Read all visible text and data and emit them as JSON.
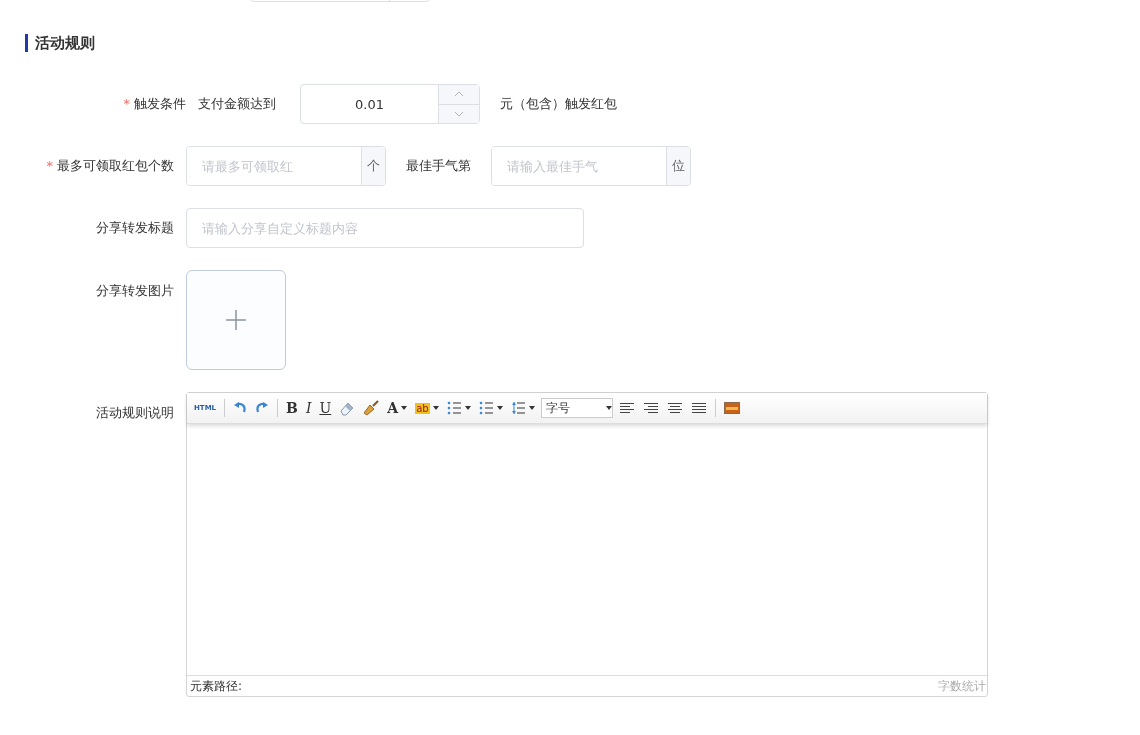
{
  "section": {
    "title": "活动规则"
  },
  "form": [
    {
      "kind": "trigger",
      "label": "触发条件",
      "required_mark": "*",
      "prefix": "支付金额达到",
      "value": "0.01",
      "suffix": "元（包含）触发红包"
    },
    {
      "kind": "pair",
      "label": "最多可领取红包个数",
      "required_mark": "*",
      "placeholder": "请最多可领取红",
      "unit": "个",
      "second_label": "最佳手气第",
      "second_placeholder": "请输入最佳手气",
      "second_unit": "位"
    },
    {
      "kind": "text",
      "label": "分享转发标题",
      "placeholder": "请输入分享自定义标题内容"
    },
    {
      "kind": "upload",
      "label": "分享转发图片"
    },
    {
      "kind": "editor",
      "label": "活动规则说明"
    }
  ],
  "editor": {
    "toolbar": [
      {
        "kind": "html",
        "text": "HTML"
      },
      {
        "kind": "sep"
      },
      {
        "kind": "undo"
      },
      {
        "kind": "redo"
      },
      {
        "kind": "sep"
      },
      {
        "kind": "bold",
        "text": "B"
      },
      {
        "kind": "italic",
        "text": "I"
      },
      {
        "kind": "underline",
        "text": "U"
      },
      {
        "kind": "eraser"
      },
      {
        "kind": "brush"
      },
      {
        "kind": "fontcolor",
        "text": "A"
      },
      {
        "kind": "highlight",
        "text": "ab"
      },
      {
        "kind": "ol"
      },
      {
        "kind": "ul"
      },
      {
        "kind": "lineheight"
      },
      {
        "kind": "fontsize",
        "text": "字号"
      },
      {
        "kind": "alignleft"
      },
      {
        "kind": "alignright"
      },
      {
        "kind": "aligncenter"
      },
      {
        "kind": "justify"
      },
      {
        "kind": "sep"
      },
      {
        "kind": "image"
      }
    ],
    "path_label": "元素路径:",
    "word_count": "字数统计"
  }
}
